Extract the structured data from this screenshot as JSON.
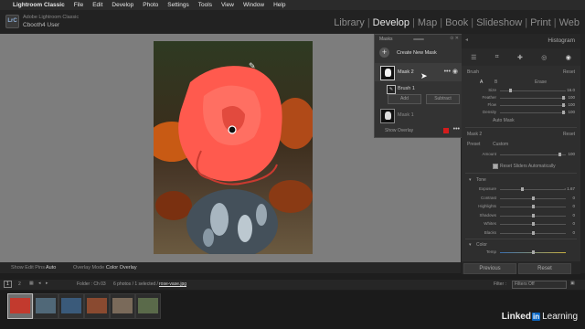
{
  "menubar": {
    "app": "Lightroom Classic",
    "items": [
      "File",
      "Edit",
      "Develop",
      "Photo",
      "Settings",
      "Tools",
      "View",
      "Window",
      "Help"
    ]
  },
  "header": {
    "app_name": "Adobe Lightroom Classic",
    "catalog_user": "Cbooth4 User",
    "logo": "LrC",
    "modules": [
      "Library",
      "Develop",
      "Map",
      "Book",
      "Slideshow",
      "Print",
      "Web"
    ],
    "active_module": "Develop"
  },
  "masks_panel": {
    "title": "Masks",
    "create_label": "Create New Mask",
    "masks": [
      {
        "name": "Mask 2",
        "selected": true
      },
      {
        "name": "Mask 1",
        "selected": false
      }
    ],
    "component": "Brush 1",
    "add_label": "Add",
    "subtract_label": "Subtract",
    "show_overlay_label": "Show Overlay",
    "overlay_color": "#d41c1c"
  },
  "right_panel": {
    "histogram_label": "Histogram",
    "brush_label": "Brush",
    "brush_reset": "Reset",
    "tabs": [
      "A",
      "B",
      "Erase"
    ],
    "brush_settings": [
      {
        "label": "Size",
        "value": "16.0",
        "level": 0.15
      },
      {
        "label": "Feather",
        "value": "100",
        "level": 1.0
      },
      {
        "label": "Flow",
        "value": "100",
        "level": 1.0
      },
      {
        "label": "Density",
        "value": "100",
        "level": 1.0
      }
    ],
    "auto_mask_label": "Auto Mask",
    "mask_section": {
      "name": "Mask 2",
      "reset": "Reset",
      "preset_label": "Preset",
      "preset_value": "Custom",
      "amount_label": "Amount",
      "amount_value": "100",
      "reset_sliders_label": "Reset Sliders Automatically"
    },
    "tone_label": "Tone",
    "tone_sliders": [
      {
        "label": "Exposure",
        "value": "- 1.67",
        "level": 0.33
      },
      {
        "label": "Contrast",
        "value": "0",
        "level": 0.5
      },
      {
        "label": "Highlights",
        "value": "0",
        "level": 0.5
      },
      {
        "label": "Shadows",
        "value": "0",
        "level": 0.5
      },
      {
        "label": "Whites",
        "value": "0",
        "level": 0.5
      },
      {
        "label": "Blacks",
        "value": "0",
        "level": 0.5
      }
    ],
    "color_label": "Color",
    "color_slider": {
      "label": "Temp",
      "level": 0.5
    },
    "previous_label": "Previous",
    "reset_label": "Reset"
  },
  "toolbar": {
    "show_edit_pins_label": "Show Edit Pins :",
    "show_edit_pins_value": "Auto",
    "overlay_mode_label": "Overlay Mode :",
    "overlay_mode_value": "Color Overlay"
  },
  "filmstrip": {
    "page_numbers": [
      "1",
      "2"
    ],
    "folder_text": "Folder : Ch 03",
    "photo_count": "6 photos / 1 selected /",
    "selected_file": "rose-vase.jpg",
    "filter_label": "Filter :",
    "filter_value": "Filters Off",
    "selected_index": 0,
    "thumbs": [
      {
        "color": "#c23a2e"
      },
      {
        "color": "#506878"
      },
      {
        "color": "#3a5a7a"
      },
      {
        "color": "#8a4a30"
      },
      {
        "color": "#7a6a5a"
      },
      {
        "color": "#5a6a4a"
      }
    ]
  },
  "branding": {
    "linkedin": "Linked",
    "in": "in",
    "learning": "Learning"
  },
  "canvas": {
    "background": "#7d7d7d",
    "overlay_color": "#ff5a4e"
  }
}
